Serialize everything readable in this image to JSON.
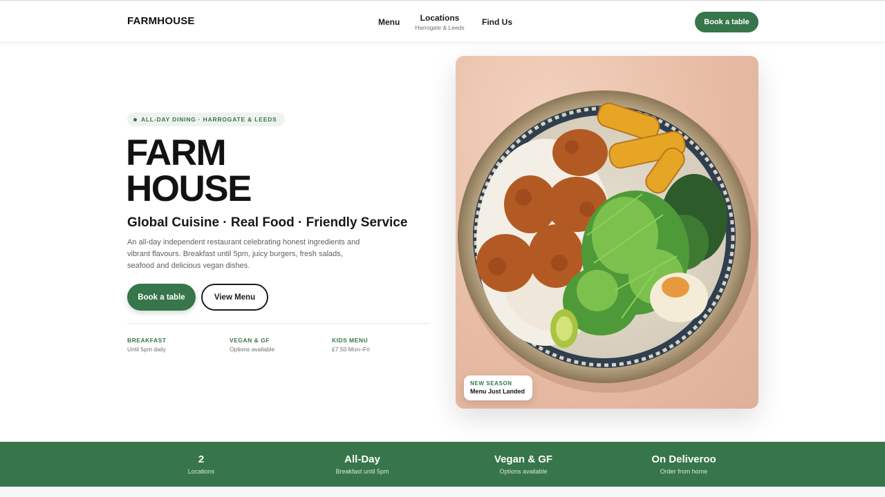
{
  "header": {
    "brand": "FARMHOUSE",
    "nav": {
      "menu": "Menu",
      "locations": "Locations",
      "locations_sub": "Harrogate & Leeds",
      "find_us": "Find Us"
    },
    "cta": "Book a table"
  },
  "hero": {
    "badge": "ALL-DAY DINING · HARROGATE & LEEDS",
    "title_line1": "FARM",
    "title_line2": "HOUSE",
    "tagline": "Global Cuisine · Real Food · Friendly Service",
    "description": "An all-day independent restaurant celebrating honest ingredients and vibrant flavours. Breakfast until 5pm, juicy burgers, fresh salads, seafood and delicious vegan dishes.",
    "primary_button": "Book a table",
    "secondary_button": "View Menu",
    "features": [
      {
        "label": "BREAKFAST",
        "sub": "Until 5pm daily"
      },
      {
        "label": "VEGAN & GF",
        "sub": "Options available"
      },
      {
        "label": "KIDS MENU",
        "sub": "£7.50 Mon–Fri"
      }
    ],
    "image_card": {
      "label": "NEW SEASON",
      "text": "Menu Just Landed"
    }
  },
  "stats": [
    {
      "value": "2",
      "sub": "Locations"
    },
    {
      "value": "All-Day",
      "sub": "Breakfast until 5pm"
    },
    {
      "value": "Vegan & GF",
      "sub": "Options available"
    },
    {
      "value": "On Deliveroo",
      "sub": "Order from home"
    }
  ],
  "colors": {
    "accent": "#37754a",
    "text": "#161616",
    "muted": "#5e5e5e"
  }
}
